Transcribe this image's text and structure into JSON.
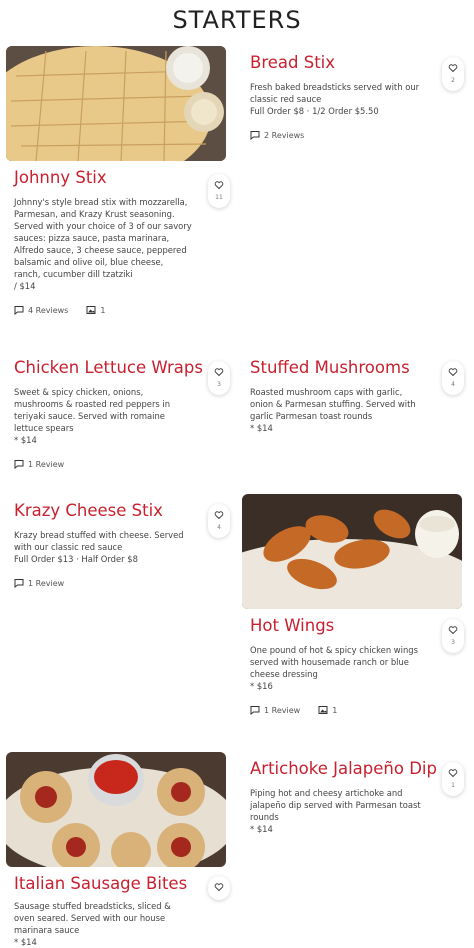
{
  "title": "STARTERS",
  "colors": {
    "accent": "#c8202f",
    "text": "#444444"
  },
  "items": [
    {
      "name": "Bread Stix",
      "desc": "Fresh baked breadsticks served with our classic red sauce",
      "price": "Full Order $8 · 1/2 Order $5.50",
      "reviews": "2 Reviews",
      "likes": "2"
    },
    {
      "name": "Johnny Stix",
      "desc": "Johnny's style bread stix with mozzarella, Parmesan, and Krazy Krust seasoning. Served with your choice of 3 of our savory sauces: pizza sauce, pasta marinara, Alfredo sauce, 3 cheese sauce, peppered balsamic and olive oil, blue cheese, ranch, cucumber dill tzatziki",
      "price": "/ $14",
      "reviews": "4 Reviews",
      "photos": "1",
      "likes": "11"
    },
    {
      "name": "Chicken Lettuce Wraps",
      "desc": "Sweet & spicy chicken, onions, mushrooms & roasted red peppers in teriyaki sauce. Served with romaine lettuce spears",
      "price": "* $14",
      "reviews": "1 Review",
      "likes": "3"
    },
    {
      "name": "Stuffed Mushrooms",
      "desc": "Roasted mushroom caps with garlic, onion & Parmesan stuffing. Served with garlic Parmesan toast rounds",
      "price": "* $14",
      "likes": "4"
    },
    {
      "name": "Krazy Cheese Stix",
      "desc": "Krazy bread stuffed with cheese. Served with our classic red sauce",
      "price": "Full Order $13 · Half Order $8",
      "reviews": "1 Review",
      "likes": "4"
    },
    {
      "name": "Hot Wings",
      "desc": "One pound of hot & spicy chicken wings served with housemade ranch or blue cheese dressing",
      "price": "* $16",
      "reviews": "1 Review",
      "photos": "1",
      "likes": "3"
    },
    {
      "name": "Artichoke Jalapeño Dip",
      "desc": "Piping hot and cheesy artichoke and jalapeño dip served with Parmesan toast rounds",
      "price": "* $14",
      "likes": "1"
    },
    {
      "name": "Italian Sausage Bites",
      "desc": "Sausage stuffed breadsticks, sliced & oven seared. Served with our house marinara sauce",
      "price": "* $14"
    }
  ]
}
